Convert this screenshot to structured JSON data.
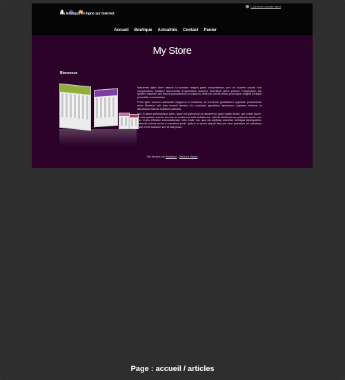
{
  "header": {
    "flags": [
      "fr-flag-icon",
      "uk-flag-icon",
      "es-flag-icon"
    ],
    "tagline": "Ma boutique en ligne sur Internet",
    "login_label": "Connexion compte client"
  },
  "nav": {
    "items": [
      "Accueil",
      "Boutique",
      "Actualités",
      "Contact",
      "Panier"
    ]
  },
  "logo": {
    "text": "My Store"
  },
  "content": {
    "welcome_heading": "Bienvenue",
    "paragraphs": [
      "Meluertes igitur idem latomo Le.aconam magna parte competentem cum se inpares nostris fore congressione stataere documentis frequentibus sciorent, fluentibus deeis pellone Pamphylium diu quidem intactam sed timore populationum et caedum, mille per omnia diffusi propinqua, magnis undique praesidiis communitam.",
      "Primi igitur omnium statuuntur Epigonus et Eusebius ob nominum gentilitatem oppressi; praediximus enim Montium sub ipso vivendi termino his vocabulis appellatos fabricarum culpasse tribunos ut adminicula futurae molitioni pollicitos.",
      "Iam in altera philosophiae parte, quae est quaerendi ac disserendi, quae logikh dicitur, iste vester plane, ut mihi quidem videtur, inermis ac nudus est. tollit definitiones, nihil de dividendo ac partiendo docet, non quo modo efficiatur concludaturque ratio tradit, non qua via captiosa solvantur ambigua distinguantur ostendit; iudicia rerum in sensibus ponit, quibus si semel aliquid falsi pro vero probatum sit, sublatum esse omne iudicium veri et falsi putat."
    ]
  },
  "footer": {
    "prefix": "Site fabriqué par",
    "link1": "Webadeur",
    "separator": "-",
    "link2": "Mentions légales"
  },
  "caption": "Page : accueil / articles"
}
